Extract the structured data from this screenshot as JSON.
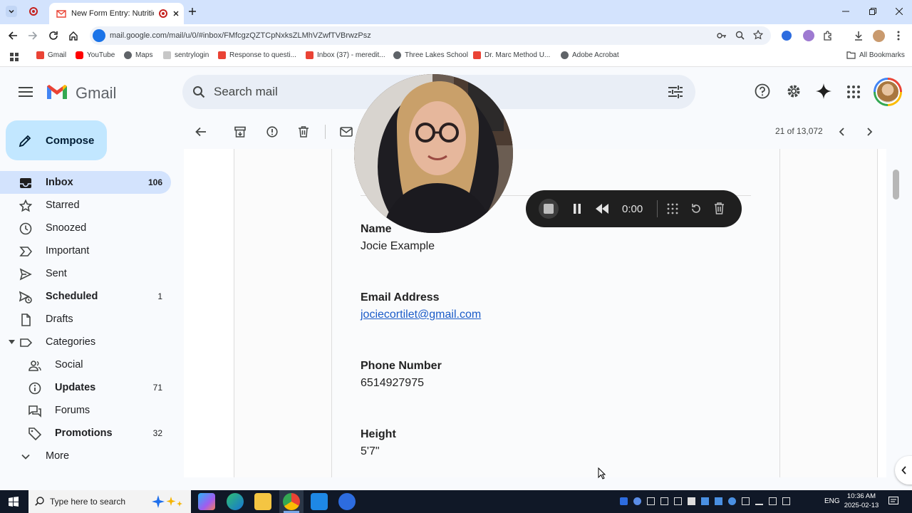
{
  "browser": {
    "tab_title": "New Form Entry: Nutrition I",
    "url": "mail.google.com/mail/u/0/#inbox/FMfcgzQZTCpNxksZLMhVZwfTVBrwzPsz",
    "bookmarks": [
      {
        "label": "Gmail",
        "color": "#ea4335"
      },
      {
        "label": "YouTube",
        "color": "#ff0000"
      },
      {
        "label": "Maps",
        "color": "#5f6368"
      },
      {
        "label": "sentrylogin",
        "color": "#9aa0a6"
      },
      {
        "label": "Response to questi...",
        "color": "#ea4335"
      },
      {
        "label": "Inbox (37) - meredit...",
        "color": "#ea4335"
      },
      {
        "label": "Three Lakes School",
        "color": "#5f6368"
      },
      {
        "label": "Dr. Marc Method U...",
        "color": "#ea4335"
      },
      {
        "label": "Adobe Acrobat",
        "color": "#5f6368"
      }
    ],
    "all_bookmarks": "All Bookmarks"
  },
  "gmail": {
    "logo_text": "Gmail",
    "search_placeholder": "Search mail",
    "compose": "Compose",
    "nav": [
      {
        "label": "Inbox",
        "count": "106",
        "icon": "inbox-icon",
        "bold": true
      },
      {
        "label": "Starred",
        "count": "",
        "icon": "star-icon",
        "bold": false
      },
      {
        "label": "Snoozed",
        "count": "",
        "icon": "clock-icon",
        "bold": false
      },
      {
        "label": "Important",
        "count": "",
        "icon": "important-icon",
        "bold": false
      },
      {
        "label": "Sent",
        "count": "",
        "icon": "send-icon",
        "bold": false
      },
      {
        "label": "Scheduled",
        "count": "1",
        "icon": "scheduled-icon",
        "bold": true
      },
      {
        "label": "Drafts",
        "count": "",
        "icon": "draft-icon",
        "bold": false
      },
      {
        "label": "Categories",
        "count": "",
        "icon": "label-icon",
        "bold": false
      },
      {
        "label": "Social",
        "count": "",
        "icon": "people-icon",
        "bold": false
      },
      {
        "label": "Updates",
        "count": "71",
        "icon": "info-icon",
        "bold": true
      },
      {
        "label": "Forums",
        "count": "",
        "icon": "forum-icon",
        "bold": false
      },
      {
        "label": "Promotions",
        "count": "32",
        "icon": "tag-icon",
        "bold": true
      },
      {
        "label": "More",
        "count": "",
        "icon": "chevron-down-icon",
        "bold": false
      }
    ],
    "pagination": "21 of 13,072"
  },
  "form": {
    "fields": [
      {
        "label": "Name",
        "value": "Jocie Example"
      },
      {
        "label": "Email Address",
        "value": "jociecortilet@gmail.com"
      },
      {
        "label": "Phone Number",
        "value": "6514927975"
      },
      {
        "label": "Height",
        "value": "5'7\""
      }
    ]
  },
  "recorder": {
    "time": "0:00"
  },
  "taskbar": {
    "search_placeholder": "Type here to search",
    "lang": "ENG",
    "time": "10:36 AM",
    "date": "2025-02-13"
  },
  "colors": {
    "inbox_highlight": "#d3e3fd",
    "compose_bg": "#c2e7ff",
    "tab_strip": "#d3e3fd",
    "link": "#1a5bc8"
  }
}
